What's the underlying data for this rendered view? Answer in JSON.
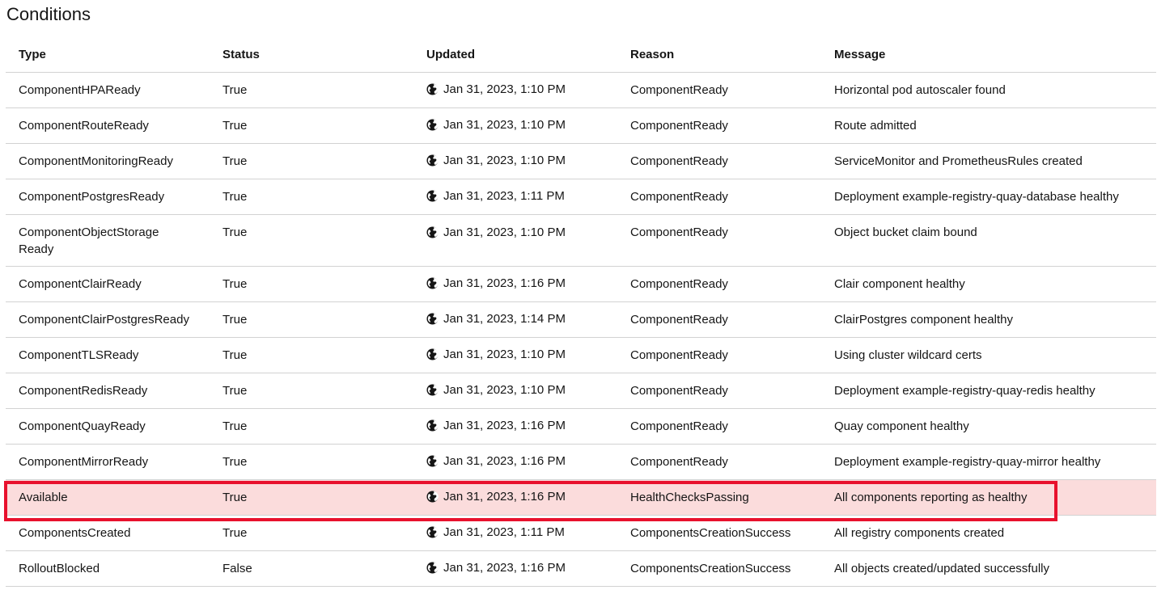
{
  "section": {
    "title": "Conditions"
  },
  "table": {
    "headers": [
      "Type",
      "Status",
      "Updated",
      "Reason",
      "Message"
    ],
    "rows": [
      {
        "type": "ComponentHPAReady",
        "status": "True",
        "updated": "Jan 31, 2023, 1:10 PM",
        "reason": "ComponentReady",
        "message": "Horizontal pod autoscaler found"
      },
      {
        "type": "ComponentRouteReady",
        "status": "True",
        "updated": "Jan 31, 2023, 1:10 PM",
        "reason": "ComponentReady",
        "message": "Route admitted"
      },
      {
        "type": "ComponentMonitoringReady",
        "status": "True",
        "updated": "Jan 31, 2023, 1:10 PM",
        "reason": "ComponentReady",
        "message": "ServiceMonitor and PrometheusRules created"
      },
      {
        "type": "ComponentPostgresReady",
        "status": "True",
        "updated": "Jan 31, 2023, 1:11 PM",
        "reason": "ComponentReady",
        "message": "Deployment example-registry-quay-database healthy"
      },
      {
        "type": "ComponentObjectStorage Ready",
        "status": "True",
        "updated": "Jan 31, 2023, 1:10 PM",
        "reason": "ComponentReady",
        "message": "Object bucket claim bound"
      },
      {
        "type": "ComponentClairReady",
        "status": "True",
        "updated": "Jan 31, 2023, 1:16 PM",
        "reason": "ComponentReady",
        "message": "Clair component healthy"
      },
      {
        "type": "ComponentClairPostgresReady",
        "status": "True",
        "updated": "Jan 31, 2023, 1:14 PM",
        "reason": "ComponentReady",
        "message": "ClairPostgres component healthy"
      },
      {
        "type": "ComponentTLSReady",
        "status": "True",
        "updated": "Jan 31, 2023, 1:10 PM",
        "reason": "ComponentReady",
        "message": "Using cluster wildcard certs"
      },
      {
        "type": "ComponentRedisReady",
        "status": "True",
        "updated": "Jan 31, 2023, 1:10 PM",
        "reason": "ComponentReady",
        "message": "Deployment example-registry-quay-redis healthy"
      },
      {
        "type": "ComponentQuayReady",
        "status": "True",
        "updated": "Jan 31, 2023, 1:16 PM",
        "reason": "ComponentReady",
        "message": "Quay component healthy"
      },
      {
        "type": "ComponentMirrorReady",
        "status": "True",
        "updated": "Jan 31, 2023, 1:16 PM",
        "reason": "ComponentReady",
        "message": "Deployment example-registry-quay-mirror healthy"
      },
      {
        "type": "Available",
        "status": "True",
        "updated": "Jan 31, 2023, 1:16 PM",
        "reason": "HealthChecksPassing",
        "message": "All components reporting as healthy"
      },
      {
        "type": "ComponentsCreated",
        "status": "True",
        "updated": "Jan 31, 2023, 1:11 PM",
        "reason": "ComponentsCreationSuccess",
        "message": "All registry components created"
      },
      {
        "type": "RolloutBlocked",
        "status": "False",
        "updated": "Jan 31, 2023, 1:16 PM",
        "reason": "ComponentsCreationSuccess",
        "message": "All objects created/updated successfully"
      }
    ]
  },
  "icons": {
    "updated_icon": "globe-icon"
  },
  "colors": {
    "highlight_border": "#e8112d",
    "highlight_fill": "#fbdcdc",
    "row_divider": "#d2d2d2"
  }
}
